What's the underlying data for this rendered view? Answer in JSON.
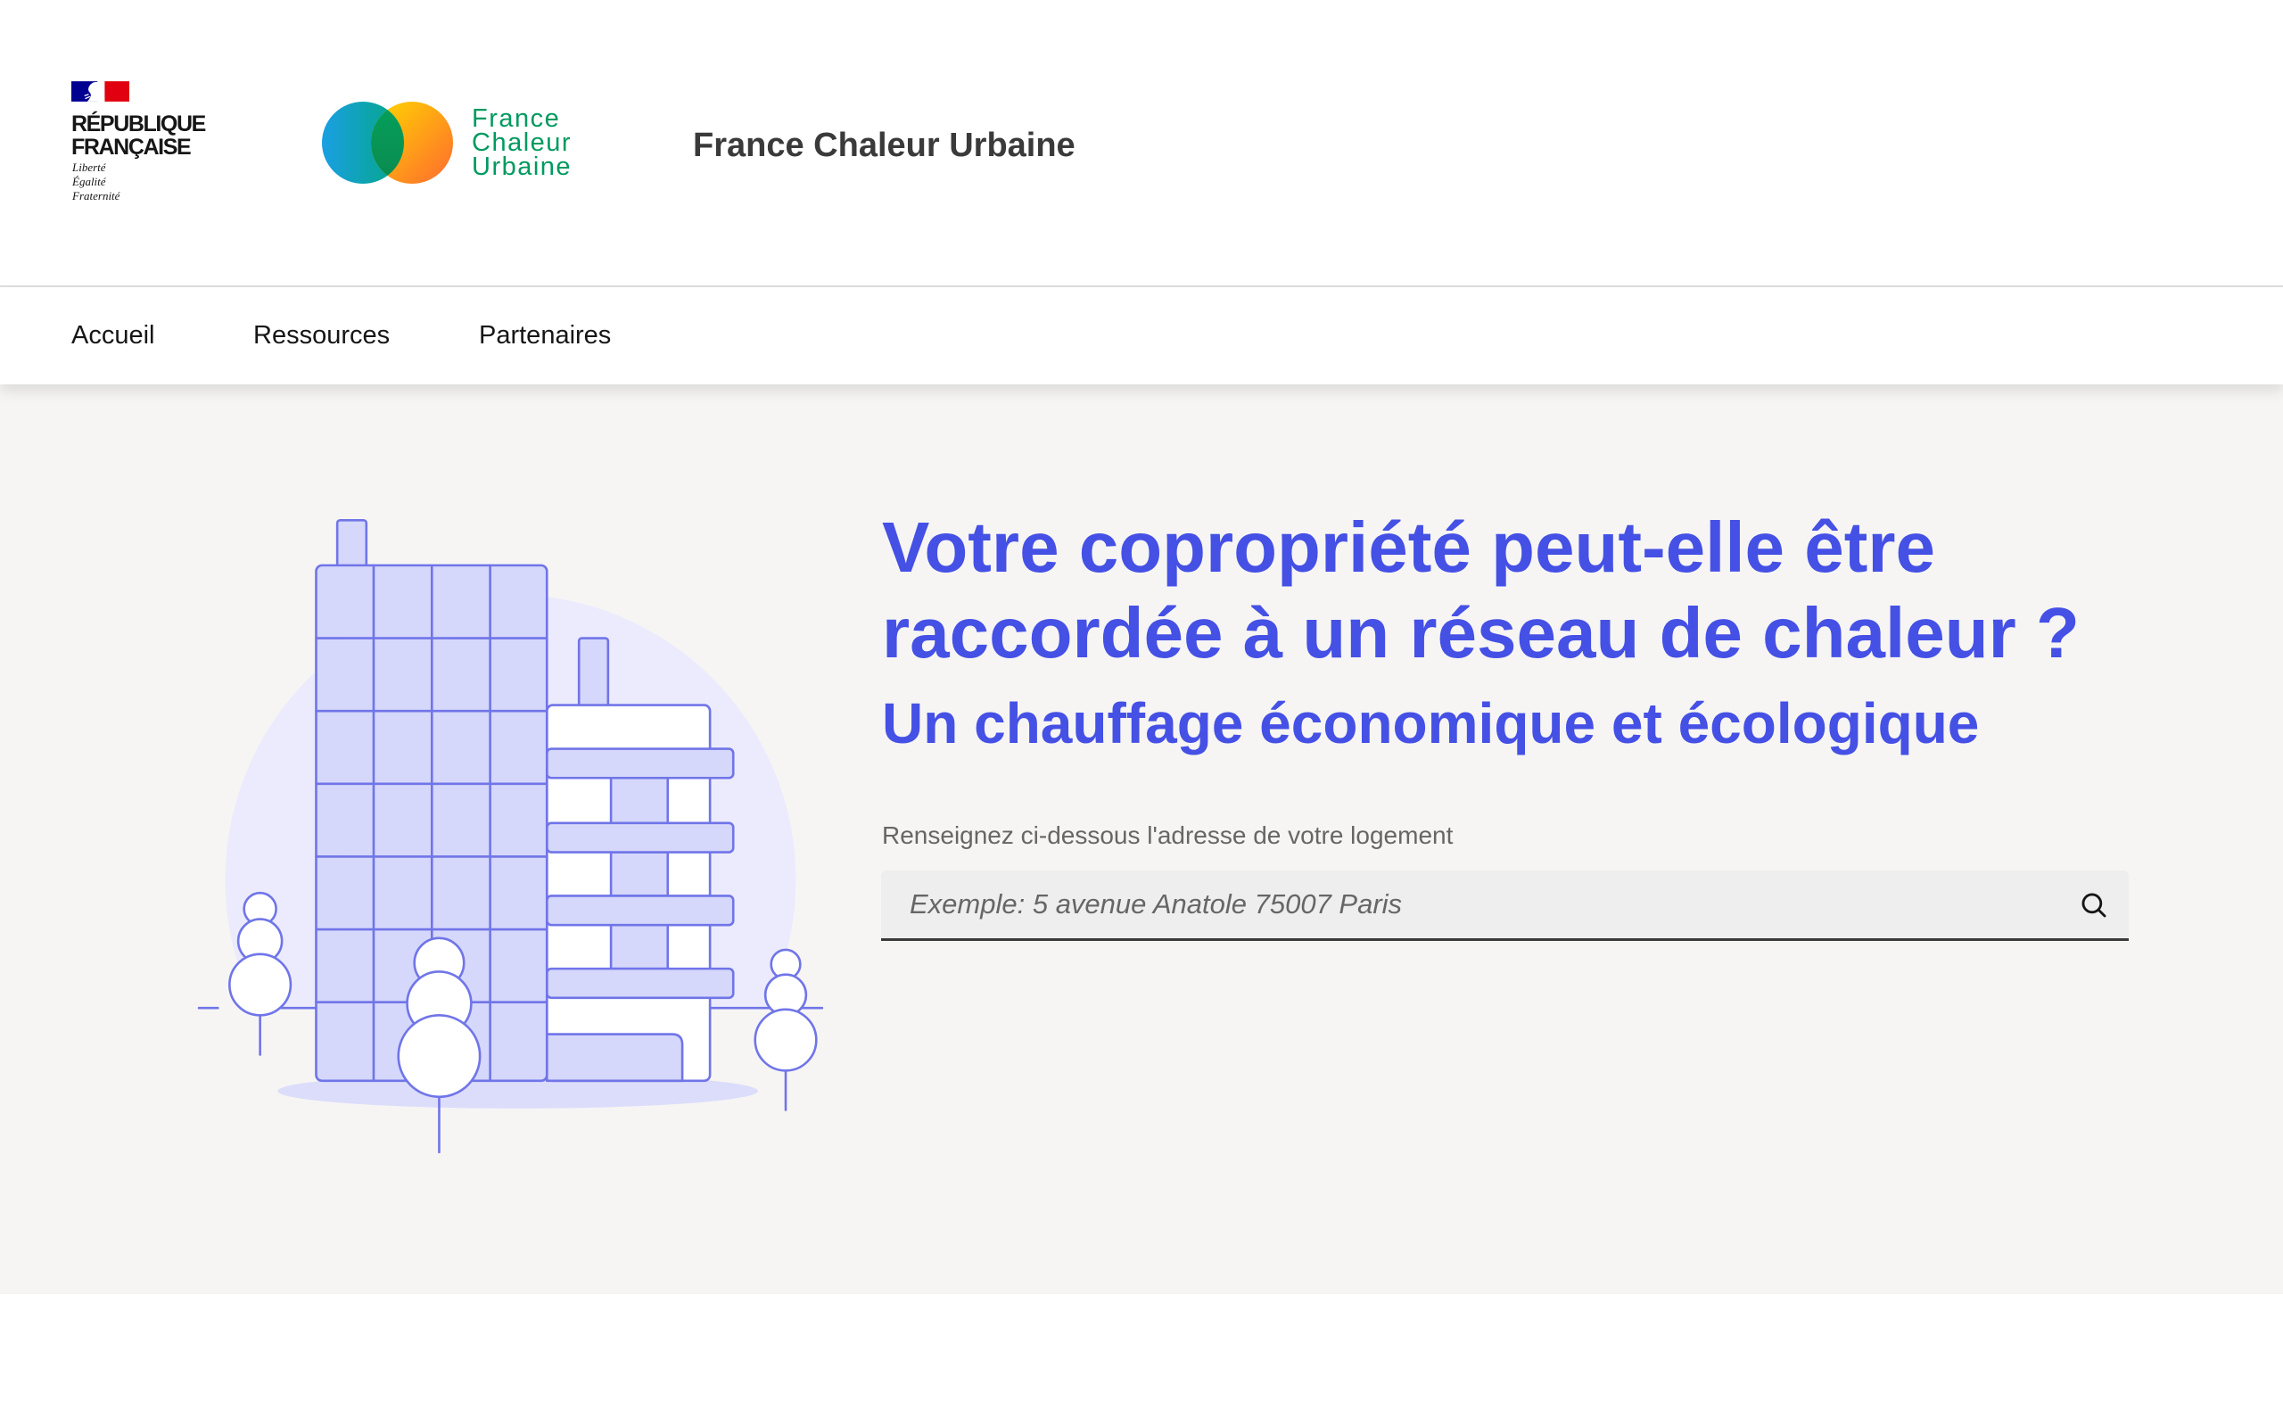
{
  "header": {
    "gov_logo": {
      "line1": "RÉPUBLIQUE",
      "line2": "FRANÇAISE",
      "motto": [
        "Liberté",
        "Égalité",
        "Fraternité"
      ]
    },
    "brand_logo": [
      "France",
      "Chaleur",
      "Urbaine"
    ],
    "site_title": "France Chaleur Urbaine"
  },
  "nav": [
    {
      "label": "Accueil"
    },
    {
      "label": "Ressources"
    },
    {
      "label": "Partenaires"
    }
  ],
  "hero": {
    "title_line1": "Votre copropriété peut-elle être",
    "title_line2": "raccordée à un réseau de chaleur ?",
    "subtitle": "Un chauffage économique et écologique",
    "search": {
      "label": "Renseignez ci-dessous l'adresse de votre logement",
      "placeholder": "Exemple: 5 avenue Anatole 75007 Paris",
      "icon": "search-icon"
    }
  },
  "colors": {
    "primary_blue": "#4550e5",
    "brand_green": "#009a5f",
    "gov_blue": "#000091",
    "gov_red": "#e1000f",
    "hero_background": "#f6f5f4",
    "illustration_stroke": "#7075e8",
    "illustration_fill": "#d5d7fb"
  }
}
